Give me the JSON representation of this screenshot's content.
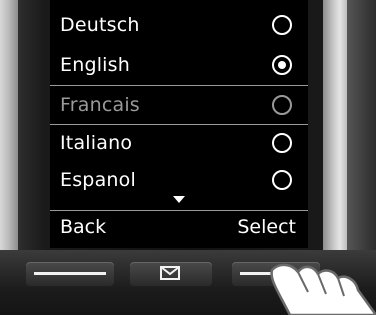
{
  "menu": {
    "items": [
      {
        "label": "Deutsch",
        "selected": false,
        "highlighted": false
      },
      {
        "label": "English",
        "selected": true,
        "highlighted": false
      },
      {
        "label": "Francais",
        "selected": false,
        "highlighted": true
      },
      {
        "label": "Italiano",
        "selected": false,
        "highlighted": false
      },
      {
        "label": "Espanol",
        "selected": false,
        "highlighted": false
      }
    ]
  },
  "softkeys": {
    "left": "Back",
    "right": "Select"
  },
  "icons": {
    "scroll": "scroll-down-arrow-icon",
    "message_key": "envelope-icon",
    "pointer": "finger-pointer-icon"
  },
  "colors": {
    "screen_background": "#000000",
    "text": "#ffffff",
    "highlight": "#9a9a9a"
  }
}
